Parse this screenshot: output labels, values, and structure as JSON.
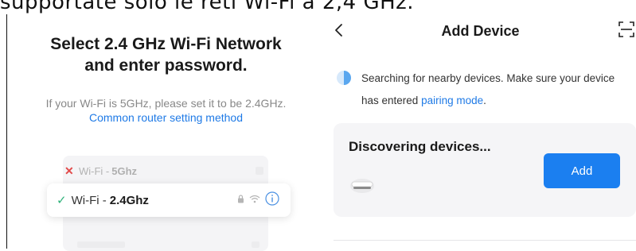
{
  "caption": "supportate solo le reti Wi-Fi a 2,4 GHz.",
  "wifi_setup": {
    "title_line1": "Select 2.4 GHz Wi-Fi Network",
    "title_line2": "and enter password.",
    "description": "If your Wi-Fi is 5GHz, please set it to be 2.4GHz.",
    "help_link": "Common router setting method",
    "networks": [
      {
        "name": "Wi-Fi - ",
        "band": "5Ghz",
        "status_icon": "x-icon",
        "status_color": "#e24a4a",
        "selected": false
      },
      {
        "name": "Wi-Fi - ",
        "band": "2.4Ghz",
        "status_icon": "check-icon",
        "status_color": "#2fb27a",
        "selected": true
      }
    ],
    "status_icons": {
      "wrong": "✕",
      "right": "✓"
    }
  },
  "add_device": {
    "header_title": "Add Device",
    "back_icon": "chevron-left-icon",
    "scan_icon": "scan-icon",
    "search_text_prefix": "Searching for nearby devices. Make sure your device has entered ",
    "search_link": "pairing mode",
    "search_text_suffix": ".",
    "discover_title": "Discovering devices...",
    "add_button_label": "Add"
  },
  "colors": {
    "accent": "#1b7ff0",
    "link": "#1f7ae6",
    "card_bg": "#f5f5f7"
  }
}
